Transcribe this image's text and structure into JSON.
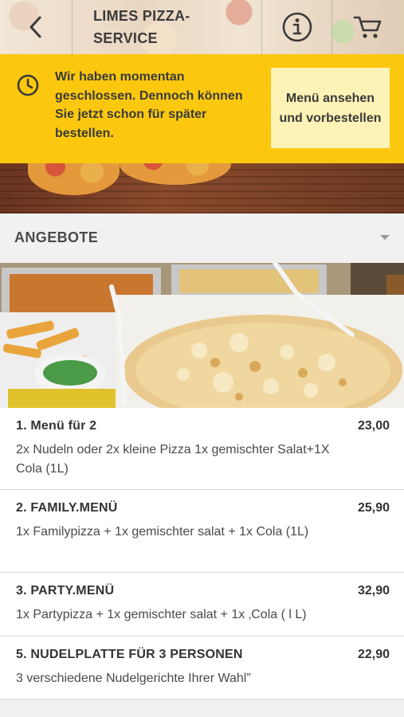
{
  "header": {
    "title": "LIMES PIZZA-\nSERVICE",
    "back_icon": "chevron-left-icon",
    "info_icon": "info-icon",
    "cart_icon": "cart-icon"
  },
  "notice": {
    "icon": "clock-icon",
    "text": "Wir haben momentan geschlossen. Dennoch können Sie jetzt schon für später bestellen.",
    "button_label": "Menü ansehen und vorbestellen",
    "background": "#fbc80f",
    "button_background": "#fdf3b6"
  },
  "category": {
    "label": "ANGEBOTE",
    "caret_icon": "caret-down-icon"
  },
  "items": [
    {
      "name": "1. Menü für 2",
      "price": "23,00",
      "description": "2x Nudeln oder 2x kleine Pizza 1x gemischter Salat+1X Cola (1L)"
    },
    {
      "name": "2. FAMILY.MENÜ",
      "price": "25,90",
      "description": "1x Familypizza + 1x gemischter salat + 1x Cola (1L)"
    },
    {
      "name": "3. PARTY.MENÜ",
      "price": "32,90",
      "description": "1x Partypizza + 1x gemischter salat + 1x ‚Cola ( l L)"
    },
    {
      "name": "5. NUDELPLATTE FÜR 3 PERSONEN",
      "price": "22,90",
      "description": "3 verschiedene Nudelgerichte Ihrer Wahl”"
    }
  ]
}
